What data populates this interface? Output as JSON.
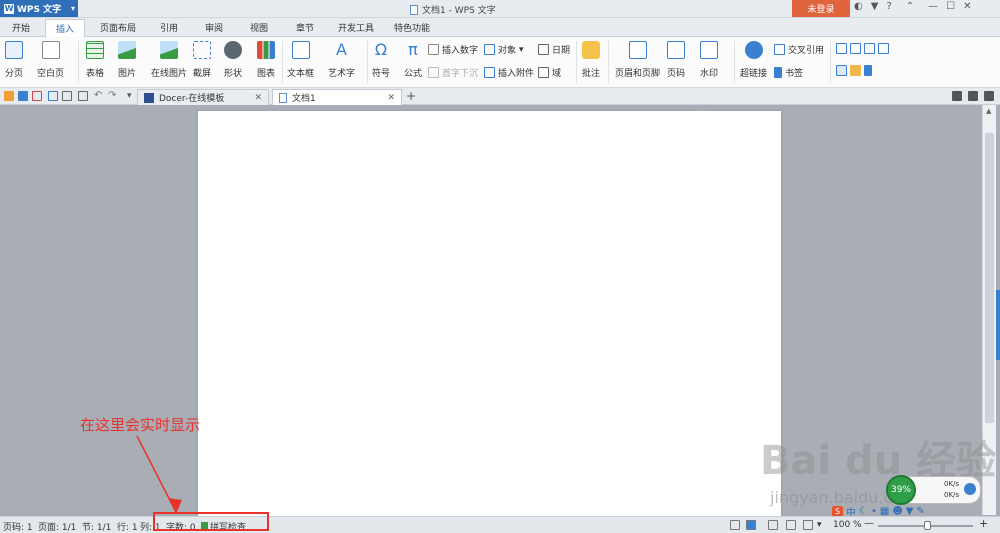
{
  "title_bar": {
    "app_name": "WPS 文字",
    "doc_title": "文档1 - WPS 文字",
    "login_label": "未登录"
  },
  "menu": {
    "tabs": [
      "开始",
      "插入",
      "页面布局",
      "引用",
      "审阅",
      "视图",
      "章节",
      "开发工具",
      "特色功能"
    ],
    "active": "插入"
  },
  "ribbon": {
    "page_break": "分页",
    "blank_page": "空白页",
    "table": "表格",
    "picture": "图片",
    "online_picture": "在线图片",
    "screenshot": "截屏",
    "shape": "形状",
    "chart": "图表",
    "text_box": "文本框",
    "word_art": "艺术字",
    "symbol": "符号",
    "formula": "公式",
    "insert_number": "插入数字",
    "object": "对象",
    "date": "日期",
    "drop_cap": "首字下沉",
    "insert_attachment": "插入附件",
    "field": "域",
    "comment": "批注",
    "header_footer": "页眉和页脚",
    "page_number": "页码",
    "watermark": "水印",
    "hyperlink": "超链接",
    "cross_reference": "交叉引用",
    "bookmark": "书签"
  },
  "doc_tabs": [
    {
      "label": "Docer-在线模板"
    },
    {
      "label": "文档1"
    }
  ],
  "annotation": "在这里会实时显示",
  "watermark": {
    "logo": "Bai du 经验",
    "url": "jingyan.baidu.com"
  },
  "net_widget": {
    "percent": "39%",
    "up": "0K/s",
    "down": "0K/s"
  },
  "ime": {
    "label": "中"
  },
  "status_bar": {
    "page": "页码: 1",
    "pages": "页面: 1/1",
    "section": "节: 1/1",
    "line": "行: 1",
    "column": "列: 1",
    "word_count": "字数: 0",
    "spell_check": "拼写检查",
    "zoom": "100 %"
  },
  "colors": {
    "accent": "#2f6fb8",
    "login": "#e0643c",
    "annotation": "#e8332b"
  }
}
